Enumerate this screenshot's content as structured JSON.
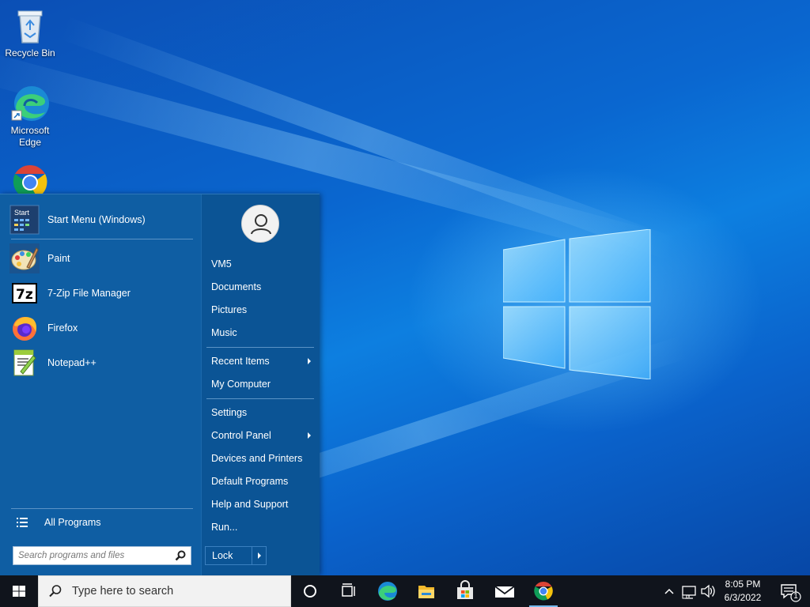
{
  "desktop": {
    "icons": [
      {
        "name": "recycle-bin",
        "label": "Recycle Bin"
      },
      {
        "name": "microsoft-edge",
        "label": "Microsoft Edge"
      },
      {
        "name": "google-chrome",
        "label": ""
      }
    ]
  },
  "start_menu": {
    "pinned": [
      {
        "label": "Start Menu (Windows)",
        "icon": "start-menu-icon"
      },
      {
        "label": "Paint",
        "icon": "paint-icon"
      },
      {
        "label": "7-Zip File Manager",
        "icon": "7zip-icon"
      },
      {
        "label": "Firefox",
        "icon": "firefox-icon"
      },
      {
        "label": "Notepad++",
        "icon": "notepadpp-icon"
      }
    ],
    "start_icon_text": "Start",
    "sevenzip_icon_text": "7z",
    "all_programs": "All Programs",
    "search_placeholder": "Search programs and files",
    "right": {
      "user": "VM5",
      "items1": [
        "Documents",
        "Pictures",
        "Music"
      ],
      "recent_items": "Recent Items",
      "my_computer": "My Computer",
      "settings": "Settings",
      "control_panel": "Control Panel",
      "devices": "Devices and Printers",
      "default_programs": "Default Programs",
      "help": "Help and Support",
      "run": "Run...",
      "lock": "Lock"
    }
  },
  "taskbar": {
    "search_placeholder": "Type here to search",
    "apps": [
      "cortana-icon",
      "task-view-icon",
      "edge-icon",
      "file-explorer-icon",
      "store-icon",
      "mail-icon",
      "chrome-icon"
    ],
    "time": "8:05 PM",
    "date": "6/3/2022",
    "notification_count": "1"
  },
  "colors": {
    "menu_left": "#0f5ea3",
    "menu_right": "#0b5495",
    "taskbar": "#10141c",
    "accent": "#0078d7"
  }
}
